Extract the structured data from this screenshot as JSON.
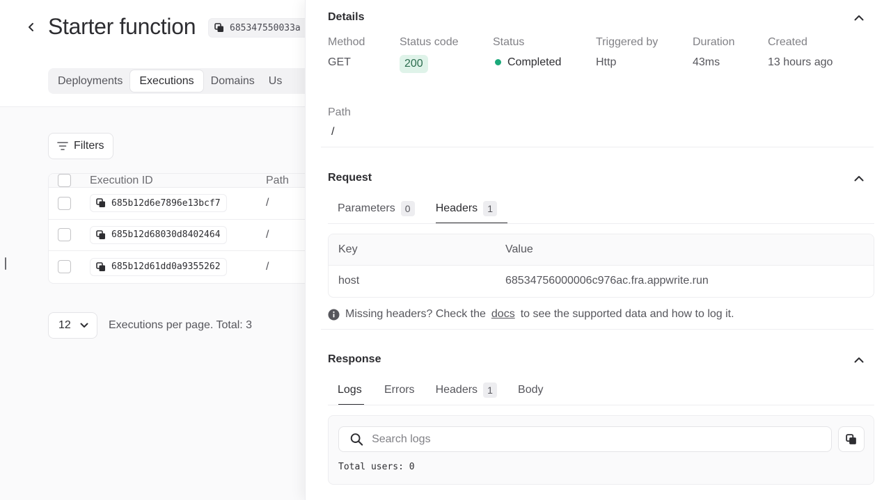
{
  "header": {
    "title": "Starter function",
    "function_id": "685347550033a"
  },
  "tabs": [
    {
      "label": "Deployments"
    },
    {
      "label": "Executions"
    },
    {
      "label": "Domains"
    },
    {
      "label": "Us"
    }
  ],
  "filters_label": "Filters",
  "table": {
    "columns": [
      "Execution ID",
      "Path"
    ],
    "rows": [
      {
        "id": "685b12d6e7896e13bcf7",
        "path": "/"
      },
      {
        "id": "685b12d68030d8402464",
        "path": "/"
      },
      {
        "id": "685b12d61dd0a9355262",
        "path": "/"
      }
    ]
  },
  "pagination": {
    "per_page": "12",
    "text": "Executions per page. Total: 3"
  },
  "details": {
    "title": "Details",
    "fields": [
      {
        "label": "Method",
        "value": "GET"
      },
      {
        "label": "Status code",
        "value": "200"
      },
      {
        "label": "Status",
        "value": "Completed"
      },
      {
        "label": "Triggered by",
        "value": "Http"
      },
      {
        "label": "Duration",
        "value": "43ms"
      },
      {
        "label": "Created",
        "value": "13 hours ago"
      }
    ],
    "path_label": "Path",
    "path_value": "/"
  },
  "request": {
    "title": "Request",
    "tabs": [
      {
        "label": "Parameters",
        "count": "0"
      },
      {
        "label": "Headers",
        "count": "1"
      }
    ],
    "table": {
      "key_header": "Key",
      "value_header": "Value",
      "rows": [
        {
          "key": "host",
          "value": "68534756000006c976ac.fra.appwrite.run"
        }
      ]
    },
    "info": {
      "before": "Missing headers? Check the",
      "link": "docs",
      "after": "to see the supported data and how to log it."
    }
  },
  "response": {
    "title": "Response",
    "tabs": [
      {
        "label": "Logs"
      },
      {
        "label": "Errors"
      },
      {
        "label": "Headers",
        "count": "1"
      },
      {
        "label": "Body"
      }
    ],
    "search_placeholder": "Search logs",
    "log_output": "Total users: 0"
  },
  "colors": {
    "success_badge_bg": "#dff3e9",
    "success_badge_text": "#2c6d4f",
    "status_dot": "#1ba97a"
  },
  "icons": [
    "chevron-left-icon",
    "copy-icon",
    "filter-icon",
    "chevron-down-icon",
    "chevron-up-icon",
    "info-icon",
    "search-icon"
  ]
}
